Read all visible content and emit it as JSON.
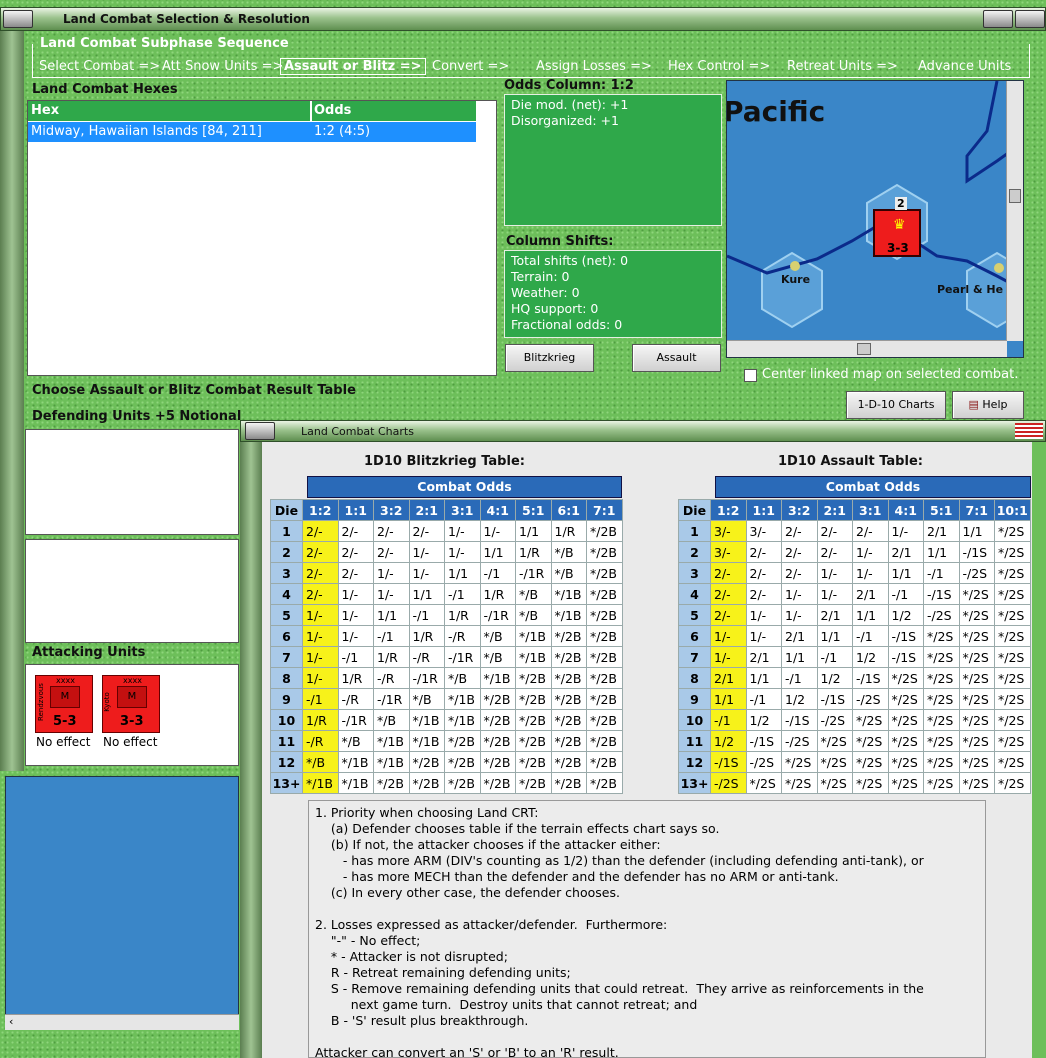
{
  "window": {
    "title": "Land Combat Selection & Resolution"
  },
  "subphase": {
    "legend": "Land Combat Subphase Sequence",
    "steps": [
      "Select Combat =>",
      "Att Snow Units =>",
      "Assault or Blitz =>",
      "Convert =>",
      "Assign Losses =>",
      "Hex Control =>",
      "Retreat Units =>",
      "Advance Units"
    ]
  },
  "hexes": {
    "title": "Land Combat Hexes",
    "col_hex": "Hex",
    "col_odds": "Odds",
    "rows": [
      {
        "hex": "Midway, Hawaiian Islands [84, 211]",
        "odds": "1:2 (4:5)"
      }
    ]
  },
  "odds_column": {
    "title": "Odds Column: 1:2",
    "lines": [
      "Die mod. (net): +1",
      "Disorganized: +1"
    ]
  },
  "column_shifts": {
    "title": "Column Shifts:",
    "lines": [
      "Total shifts (net): 0",
      "Terrain: 0",
      "Weather: 0",
      "HQ support: 0",
      "Fractional odds: 0"
    ]
  },
  "buttons": {
    "blitz": "Blitzkrieg",
    "assault": "Assault",
    "charts": "1-D-10 Charts",
    "help": "Help"
  },
  "map": {
    "label_pacific": "Pacific",
    "label_kure": "Kure",
    "label_pearl": "Pearl & He",
    "stack_count": "2",
    "unit_strength": "3-3",
    "center_option": "Center linked map on selected combat."
  },
  "choose_label": "Choose Assault or Blitz Combat Result Table",
  "defending": {
    "title": "Defending Units +5 Notional"
  },
  "attacking": {
    "title": "Attacking Units",
    "units": [
      {
        "size": "xxxx",
        "type": "M",
        "name": "Rendzvous",
        "strength": "5-3",
        "result": "No effect"
      },
      {
        "size": "xxxx",
        "type": "M",
        "name": "Kyoto",
        "strength": "3-3",
        "result": "No effect"
      }
    ]
  },
  "charts_window": {
    "title": "Land Combat Charts"
  },
  "blitz_table": {
    "title": "1D10 Blitzkrieg Table:",
    "header": "Combat Odds",
    "die_label": "Die",
    "cols": [
      "1:2",
      "1:1",
      "3:2",
      "2:1",
      "3:1",
      "4:1",
      "5:1",
      "6:1",
      "7:1"
    ],
    "rows": [
      [
        "1",
        "2/-",
        "2/-",
        "2/-",
        "2/-",
        "1/-",
        "1/-",
        "1/1",
        "1/R",
        "*/2B"
      ],
      [
        "2",
        "2/-",
        "2/-",
        "2/-",
        "1/-",
        "1/-",
        "1/1",
        "1/R",
        "*/B",
        "*/2B"
      ],
      [
        "3",
        "2/-",
        "2/-",
        "1/-",
        "1/-",
        "1/1",
        "-/1",
        "-/1R",
        "*/B",
        "*/2B"
      ],
      [
        "4",
        "2/-",
        "1/-",
        "1/-",
        "1/1",
        "-/1",
        "1/R",
        "*/B",
        "*/1B",
        "*/2B"
      ],
      [
        "5",
        "1/-",
        "1/-",
        "1/1",
        "-/1",
        "1/R",
        "-/1R",
        "*/B",
        "*/1B",
        "*/2B"
      ],
      [
        "6",
        "1/-",
        "1/-",
        "-/1",
        "1/R",
        "-/R",
        "*/B",
        "*/1B",
        "*/2B",
        "*/2B"
      ],
      [
        "7",
        "1/-",
        "-/1",
        "1/R",
        "-/R",
        "-/1R",
        "*/B",
        "*/1B",
        "*/2B",
        "*/2B"
      ],
      [
        "8",
        "1/-",
        "1/R",
        "-/R",
        "-/1R",
        "*/B",
        "*/1B",
        "*/2B",
        "*/2B",
        "*/2B"
      ],
      [
        "9",
        "-/1",
        "-/R",
        "-/1R",
        "*/B",
        "*/1B",
        "*/2B",
        "*/2B",
        "*/2B",
        "*/2B"
      ],
      [
        "10",
        "1/R",
        "-/1R",
        "*/B",
        "*/1B",
        "*/1B",
        "*/2B",
        "*/2B",
        "*/2B",
        "*/2B"
      ],
      [
        "11",
        "-/R",
        "*/B",
        "*/1B",
        "*/1B",
        "*/2B",
        "*/2B",
        "*/2B",
        "*/2B",
        "*/2B"
      ],
      [
        "12",
        "*/B",
        "*/1B",
        "*/1B",
        "*/2B",
        "*/2B",
        "*/2B",
        "*/2B",
        "*/2B",
        "*/2B"
      ],
      [
        "13+",
        "*/1B",
        "*/1B",
        "*/2B",
        "*/2B",
        "*/2B",
        "*/2B",
        "*/2B",
        "*/2B",
        "*/2B"
      ]
    ]
  },
  "assault_table": {
    "title": "1D10 Assault Table:",
    "header": "Combat Odds",
    "die_label": "Die",
    "cols": [
      "1:2",
      "1:1",
      "3:2",
      "2:1",
      "3:1",
      "4:1",
      "5:1",
      "7:1",
      "10:1"
    ],
    "rows": [
      [
        "1",
        "3/-",
        "3/-",
        "2/-",
        "2/-",
        "2/-",
        "1/-",
        "2/1",
        "1/1",
        "*/2S"
      ],
      [
        "2",
        "3/-",
        "2/-",
        "2/-",
        "2/-",
        "1/-",
        "2/1",
        "1/1",
        "-/1S",
        "*/2S"
      ],
      [
        "3",
        "2/-",
        "2/-",
        "2/-",
        "1/-",
        "1/-",
        "1/1",
        "-/1",
        "-/2S",
        "*/2S"
      ],
      [
        "4",
        "2/-",
        "2/-",
        "1/-",
        "1/-",
        "2/1",
        "-/1",
        "-/1S",
        "*/2S",
        "*/2S"
      ],
      [
        "5",
        "2/-",
        "1/-",
        "1/-",
        "2/1",
        "1/1",
        "1/2",
        "-/2S",
        "*/2S",
        "*/2S"
      ],
      [
        "6",
        "1/-",
        "1/-",
        "2/1",
        "1/1",
        "-/1",
        "-/1S",
        "*/2S",
        "*/2S",
        "*/2S"
      ],
      [
        "7",
        "1/-",
        "2/1",
        "1/1",
        "-/1",
        "1/2",
        "-/1S",
        "*/2S",
        "*/2S",
        "*/2S"
      ],
      [
        "8",
        "2/1",
        "1/1",
        "-/1",
        "1/2",
        "-/1S",
        "*/2S",
        "*/2S",
        "*/2S",
        "*/2S"
      ],
      [
        "9",
        "1/1",
        "-/1",
        "1/2",
        "-/1S",
        "-/2S",
        "*/2S",
        "*/2S",
        "*/2S",
        "*/2S"
      ],
      [
        "10",
        "-/1",
        "1/2",
        "-/1S",
        "-/2S",
        "*/2S",
        "*/2S",
        "*/2S",
        "*/2S",
        "*/2S"
      ],
      [
        "11",
        "1/2",
        "-/1S",
        "-/2S",
        "*/2S",
        "*/2S",
        "*/2S",
        "*/2S",
        "*/2S",
        "*/2S"
      ],
      [
        "12",
        "-/1S",
        "-/2S",
        "*/2S",
        "*/2S",
        "*/2S",
        "*/2S",
        "*/2S",
        "*/2S",
        "*/2S"
      ],
      [
        "13+",
        "-/2S",
        "*/2S",
        "*/2S",
        "*/2S",
        "*/2S",
        "*/2S",
        "*/2S",
        "*/2S",
        "*/2S"
      ]
    ]
  },
  "highlight_col_index": 0,
  "notes": "1. Priority when choosing Land CRT:\n    (a) Defender chooses table if the terrain effects chart says so.\n    (b) If not, the attacker chooses if the attacker either:\n       - has more ARM (DIV's counting as 1/2) than the defender (including defending anti-tank), or\n       - has more MECH than the defender and the defender has no ARM or anti-tank.\n    (c) In every other case, the defender chooses.\n\n2. Losses expressed as attacker/defender.  Furthermore:\n    \"-\" - No effect;\n    * - Attacker is not disrupted;\n    R - Retreat remaining defending units;\n    S - Remove remaining defending units that could retreat.  They arrive as reinforcements in the\n         next game turn.  Destroy units that cannot retreat; and\n    B - 'S' result plus breakthrough.\n\nAttacker can convert an 'S' or 'B' to an 'R' result.",
  "colors": {
    "grass": "#6dbf5a",
    "panel_green": "#2fa84a",
    "table_header": "#2a6ab8",
    "die_col": "#a9c9e8",
    "highlight": "#f7f21a",
    "sea": "#3a86c8",
    "unit_red": "#ee1c1c"
  }
}
